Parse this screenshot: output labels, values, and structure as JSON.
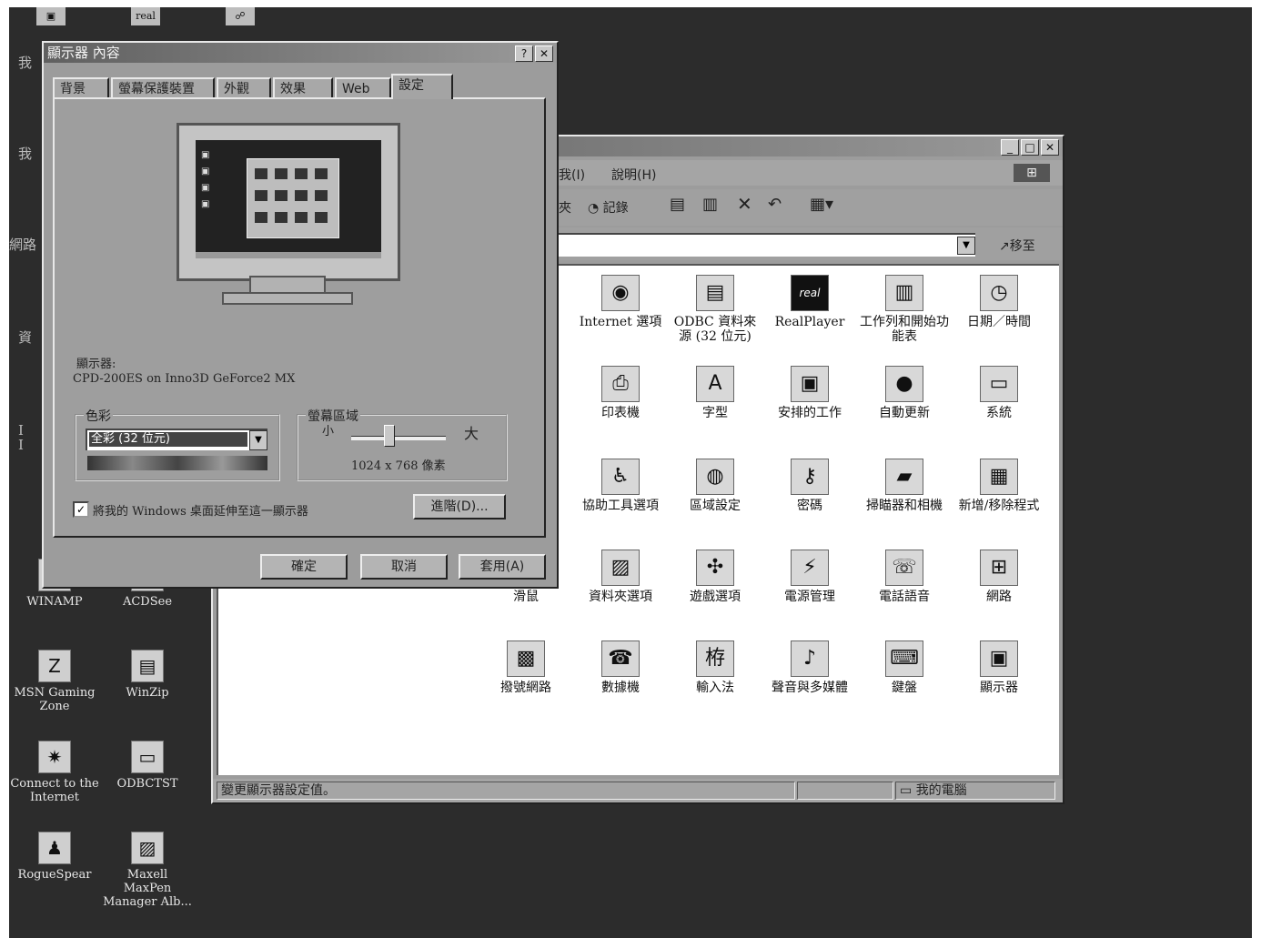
{
  "desktop": {
    "icons": [
      {
        "label": "WINAMP",
        "icon": "winamp-icon",
        "glyph": "↗"
      },
      {
        "label": "ACDSee",
        "icon": "acdsee-icon",
        "glyph": "▦"
      },
      {
        "label": "MSN Gaming Zone",
        "icon": "msn-gaming-zone-icon",
        "glyph": "Z"
      },
      {
        "label": "WinZip",
        "icon": "winzip-icon",
        "glyph": "▤"
      },
      {
        "label": "Connect to the Internet",
        "icon": "connect-internet-icon",
        "glyph": "✷"
      },
      {
        "label": "ODBCTST",
        "icon": "odbctst-icon",
        "glyph": "▭"
      },
      {
        "label": "RogueSpear",
        "icon": "roguespear-icon",
        "glyph": "♟"
      },
      {
        "label": "Maxell MaxPen Manager Alb...",
        "icon": "folder-icon",
        "glyph": "▨"
      }
    ],
    "top_icons": [
      {
        "icon": "desktop-shortcut-icon",
        "glyph": "▣"
      },
      {
        "icon": "realplayer-icon",
        "glyph": "real"
      },
      {
        "icon": "network-shortcut-icon",
        "glyph": "☍"
      }
    ],
    "clipped_labels": [
      "我",
      "我",
      "網路",
      "資",
      "I",
      "I"
    ]
  },
  "control_panel": {
    "menu_partial": [
      "我(I)",
      "說明(H)"
    ],
    "toolbar_partial": [
      "夾",
      "記錄"
    ],
    "toolbar_icons": [
      "move-icon",
      "copy-icon",
      "delete-icon",
      "undo-icon",
      "views-icon"
    ],
    "go_label": "移至",
    "items": [
      {
        "label": "Internet 選項",
        "icon": "internet-options-icon",
        "glyph": "◉"
      },
      {
        "label": "ODBC 資料來源 (32 位元)",
        "icon": "odbc-icon",
        "glyph": "▤"
      },
      {
        "label": "RealPlayer",
        "icon": "realplayer-icon",
        "glyph": "real"
      },
      {
        "label": "工作列和開始功能表",
        "icon": "taskbar-icon",
        "glyph": "▥"
      },
      {
        "label": "日期／時間",
        "icon": "datetime-icon",
        "glyph": "◷"
      },
      {
        "label": "印表機",
        "icon": "printers-icon",
        "glyph": "⎙"
      },
      {
        "label": "字型",
        "icon": "fonts-icon",
        "glyph": "A"
      },
      {
        "label": "安排的工作",
        "icon": "scheduled-tasks-icon",
        "glyph": "▣"
      },
      {
        "label": "自動更新",
        "icon": "auto-update-icon",
        "glyph": "●"
      },
      {
        "label": "系統",
        "icon": "system-icon",
        "glyph": "▭"
      },
      {
        "label": "協助工具選項",
        "icon": "accessibility-icon",
        "glyph": "♿"
      },
      {
        "label": "區域設定",
        "icon": "regional-settings-icon",
        "glyph": "◍"
      },
      {
        "label": "密碼",
        "icon": "passwords-icon",
        "glyph": "⚷"
      },
      {
        "label": "掃瞄器和相機",
        "icon": "scanners-icon",
        "glyph": "▰"
      },
      {
        "label": "新增/移除程式",
        "icon": "add-remove-programs-icon",
        "glyph": "▦"
      },
      {
        "label": "滑鼠",
        "icon": "mouse-icon",
        "glyph": "◖"
      },
      {
        "label": "資料夾選項",
        "icon": "folder-options-icon",
        "glyph": "▨"
      },
      {
        "label": "遊戲選項",
        "icon": "game-controllers-icon",
        "glyph": "✣"
      },
      {
        "label": "電源管理",
        "icon": "power-management-icon",
        "glyph": "⚡"
      },
      {
        "label": "電話語音",
        "icon": "telephony-icon",
        "glyph": "☏"
      },
      {
        "label": "網路",
        "icon": "network-icon",
        "glyph": "⊞"
      },
      {
        "label": "撥號網路",
        "icon": "dialup-networking-icon",
        "glyph": "▩"
      },
      {
        "label": "數據機",
        "icon": "modems-icon",
        "glyph": "☎"
      },
      {
        "label": "輸入法",
        "icon": "input-method-icon",
        "glyph": "栫"
      },
      {
        "label": "聲音與多媒體",
        "icon": "sounds-multimedia-icon",
        "glyph": "♪"
      },
      {
        "label": "鍵盤",
        "icon": "keyboard-icon",
        "glyph": "⌨"
      },
      {
        "label": "顯示器",
        "icon": "display-icon",
        "glyph": "▣"
      }
    ],
    "status_text": "變更顯示器設定值。",
    "status_location": "我的電腦"
  },
  "dialog": {
    "title": "顯示器 內容",
    "help_btn": "?",
    "close_btn": "✕",
    "tabs": [
      "背景",
      "螢幕保護裝置",
      "外觀",
      "效果",
      "Web",
      "設定"
    ],
    "active_tab": 5,
    "display_label": "顯示器:",
    "display_name": "CPD-200ES on Inno3D GeForce2 MX",
    "colors_group": "色彩",
    "colors_value": "全彩 (32 位元)",
    "area_group": "螢幕區域",
    "area_small": "小",
    "area_large": "大",
    "area_value": "1024 x 768 像素",
    "extend_checkbox": "將我的 Windows 桌面延伸至這一顯示器",
    "extend_checked": true,
    "advanced_btn": "進階(D)...",
    "ok_btn": "確定",
    "cancel_btn": "取消",
    "apply_btn": "套用(A)"
  }
}
